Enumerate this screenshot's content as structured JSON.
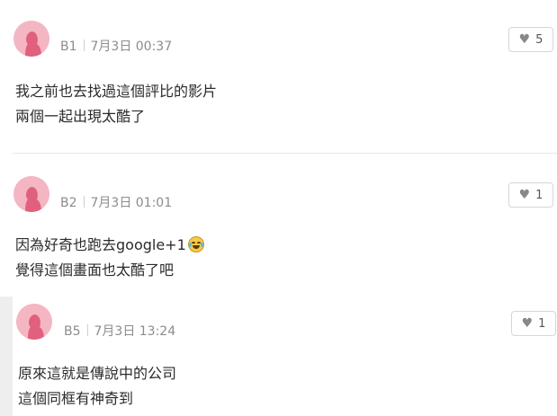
{
  "comments": [
    {
      "floor": "B1",
      "date": "7月3日 00:37",
      "likes": "5",
      "lines": [
        "我之前也去找過這個評比的影片",
        "兩個一起出現太酷了"
      ]
    },
    {
      "floor": "B2",
      "date": "7月3日 01:01",
      "likes": "1",
      "lines": [
        "因為好奇也跑去google+1",
        "覺得這個畫面也太酷了吧"
      ],
      "emoji": "laughing-with-tears-emoji"
    },
    {
      "floor": "B5",
      "date": "7月3日 13:24",
      "likes": "1",
      "lines": [
        "原來這就是傳說中的公司",
        "這個同框有神奇到"
      ]
    }
  ],
  "colors": {
    "avatar_bg": "#f4b6c2",
    "avatar_figure": "#e0607e",
    "meta_text": "#8c8c8c",
    "divider": "#e6e6e6"
  },
  "icons": [
    "female-avatar-icon",
    "heart-icon"
  ]
}
